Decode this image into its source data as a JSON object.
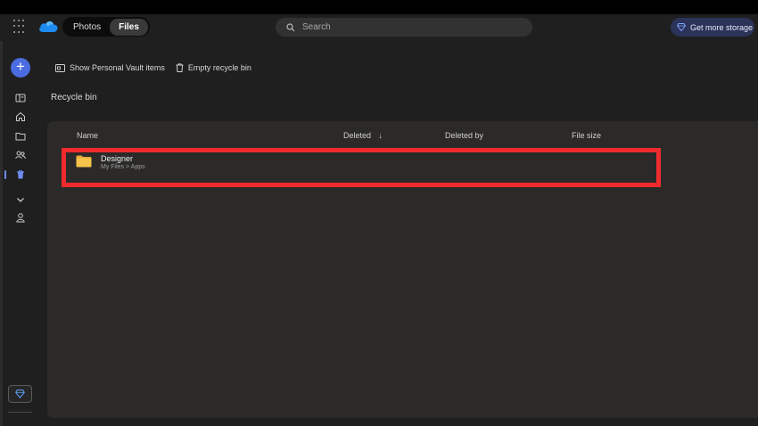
{
  "topbar": {
    "tabs": [
      {
        "label": "Photos",
        "active": false
      },
      {
        "label": "Files",
        "active": true
      }
    ],
    "search": {
      "placeholder": "Search"
    },
    "storage_button": {
      "label": "Get more storage"
    }
  },
  "sidebar": {
    "items": [
      {
        "name": "library",
        "icon": "library-icon"
      },
      {
        "name": "home",
        "icon": "home-icon"
      },
      {
        "name": "my-files",
        "icon": "folder-icon"
      },
      {
        "name": "shared",
        "icon": "people-icon"
      },
      {
        "name": "recycle-bin",
        "icon": "trash-icon",
        "active": true
      },
      {
        "name": "more",
        "icon": "chevron-down-icon"
      },
      {
        "name": "people",
        "icon": "person-icon"
      }
    ]
  },
  "toolbar": {
    "vault_label": "Show Personal Vault items",
    "empty_label": "Empty recycle bin"
  },
  "page": {
    "title": "Recycle bin"
  },
  "table": {
    "columns": {
      "name": "Name",
      "deleted": "Deleted",
      "deleted_sort": "↓",
      "deleted_by": "Deleted by",
      "file_size": "File size"
    },
    "rows": [
      {
        "name": "Designer",
        "path": "My Files > Apps",
        "deleted": "",
        "deleted_by": "",
        "file_size": ""
      }
    ]
  },
  "colors": {
    "background": "#1f1f1f",
    "panel": "#2b2a29",
    "accent": "#4a6ce0",
    "highlight": "#f02b2d",
    "folder": "#f7c34a"
  }
}
